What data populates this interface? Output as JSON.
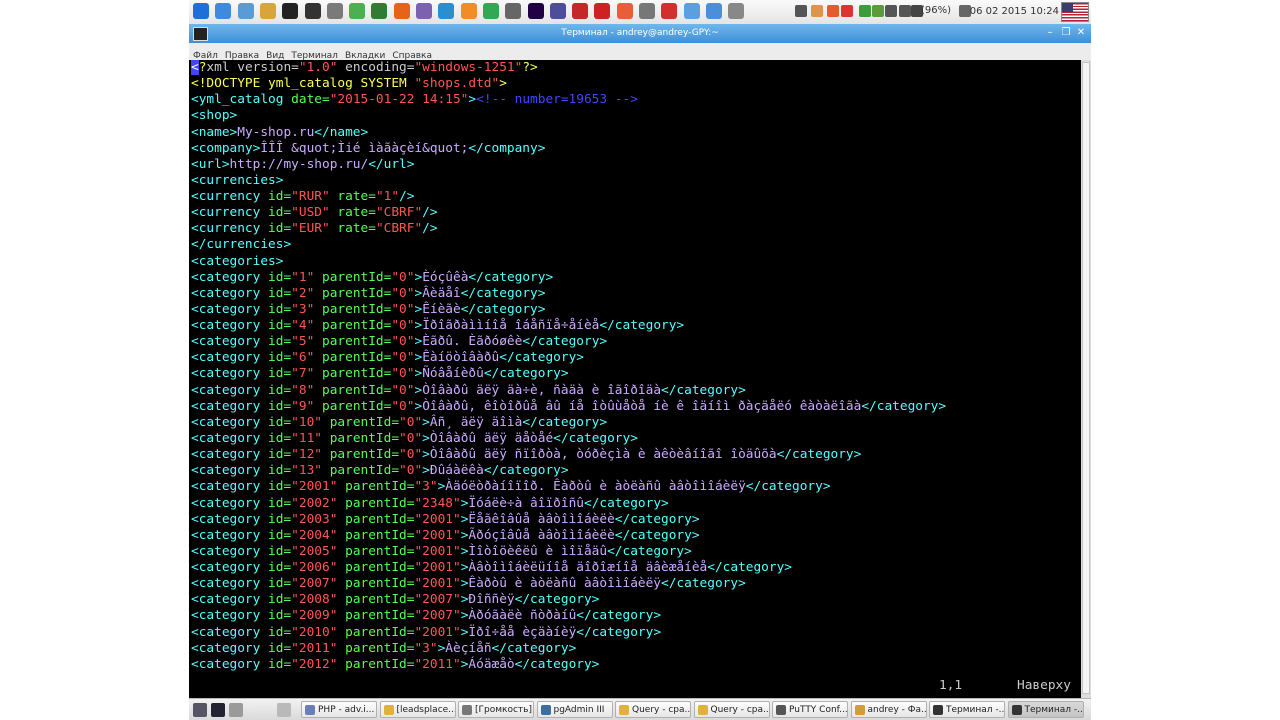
{
  "colors": {
    "tag": "#55ffff",
    "attr": "#55ff55",
    "value": "#ff5555",
    "text": "#ccaaff",
    "declaration": "#ffff55",
    "comment": "#4444ff",
    "cursor": "#4444ff",
    "default": "#cccccc"
  },
  "top_panel": {
    "launcher_icons": [
      "start-menu-icon",
      "files-icon",
      "globe-icon",
      "gimp-icon",
      "puzzle-icon",
      "terminal-icon",
      "pencil-icon",
      "play-icon",
      "leaf-icon",
      "firefox-icon",
      "bug-icon",
      "image-icon",
      "paint-icon",
      "spreadsheet-icon",
      "grid-icon",
      "monitor-icon",
      "circle-icon",
      "filezilla-icon",
      "opera-icon",
      "record-icon",
      "compass-icon",
      "stop-icon",
      "chat-icon",
      "mail-icon",
      "settings-icon"
    ],
    "tray_icons": [
      "bluetooth-icon",
      "clipboard-icon",
      "shield-icon",
      "calendar-icon",
      "download-icon",
      "update-icon",
      "network-icon",
      "volume-icon",
      "battery-icon",
      "mail-tray-icon"
    ],
    "battery": "(96%)",
    "datetime": "06 02 2015 10:24",
    "flag": "us-flag-icon"
  },
  "window": {
    "title": "Терминал - andrey@andrey-GPY:~"
  },
  "menu": [
    "Файл",
    "Правка",
    "Вид",
    "Терминал",
    "Вкладки",
    "Справка"
  ],
  "terminal": {
    "lines": [
      [
        [
          "cursor",
          "<"
        ],
        [
          "declaration",
          "?"
        ],
        [
          "default",
          "xml version="
        ],
        [
          "value",
          "\"1.0\""
        ],
        [
          "default",
          " encoding="
        ],
        [
          "value",
          "\"windows-1251\""
        ],
        [
          "declaration",
          "?>"
        ]
      ],
      [
        [
          "declaration",
          "<!DOCTYPE yml_catalog SYSTEM "
        ],
        [
          "value",
          "\"shops.dtd\""
        ],
        [
          "declaration",
          ">"
        ]
      ],
      [
        [
          "tag",
          "<yml_catalog "
        ],
        [
          "attr",
          "date="
        ],
        [
          "value",
          "\"2015-01-22 14:15\""
        ],
        [
          "tag",
          ">"
        ],
        [
          "comment",
          "<!-- number=19653 -->"
        ]
      ],
      [
        [
          "tag",
          "<shop>"
        ]
      ],
      [
        [
          "tag",
          "<name>"
        ],
        [
          "text",
          "My-shop.ru"
        ],
        [
          "tag",
          "</name>"
        ]
      ],
      [
        [
          "tag",
          "<company>"
        ],
        [
          "text",
          "ÎÎÎ &quot;Ìié ìàãàçèí&quot;"
        ],
        [
          "tag",
          "</company>"
        ]
      ],
      [
        [
          "tag",
          "<url>"
        ],
        [
          "text",
          "http://my-shop.ru/"
        ],
        [
          "tag",
          "</url>"
        ]
      ],
      [
        [
          "tag",
          "<currencies>"
        ]
      ],
      [
        [
          "tag",
          "<currency "
        ],
        [
          "attr",
          "id="
        ],
        [
          "value",
          "\"RUR\""
        ],
        [
          "attr",
          " rate="
        ],
        [
          "value",
          "\"1\""
        ],
        [
          "tag",
          "/>"
        ]
      ],
      [
        [
          "tag",
          "<currency "
        ],
        [
          "attr",
          "id="
        ],
        [
          "value",
          "\"USD\""
        ],
        [
          "attr",
          " rate="
        ],
        [
          "value",
          "\"CBRF\""
        ],
        [
          "tag",
          "/>"
        ]
      ],
      [
        [
          "tag",
          "<currency "
        ],
        [
          "attr",
          "id="
        ],
        [
          "value",
          "\"EUR\""
        ],
        [
          "attr",
          " rate="
        ],
        [
          "value",
          "\"CBRF\""
        ],
        [
          "tag",
          "/>"
        ]
      ],
      [
        [
          "tag",
          "</currencies>"
        ]
      ],
      [
        [
          "tag",
          "<categories>"
        ]
      ],
      [
        [
          "tag",
          "<category "
        ],
        [
          "attr",
          "id="
        ],
        [
          "value",
          "\"1\""
        ],
        [
          "attr",
          " parentId="
        ],
        [
          "value",
          "\"0\""
        ],
        [
          "tag",
          ">"
        ],
        [
          "text",
          "Èóçûêà"
        ],
        [
          "tag",
          "</category>"
        ]
      ],
      [
        [
          "tag",
          "<category "
        ],
        [
          "attr",
          "id="
        ],
        [
          "value",
          "\"2\""
        ],
        [
          "attr",
          " parentId="
        ],
        [
          "value",
          "\"0\""
        ],
        [
          "tag",
          ">"
        ],
        [
          "text",
          "Âèäåî"
        ],
        [
          "tag",
          "</category>"
        ]
      ],
      [
        [
          "tag",
          "<category "
        ],
        [
          "attr",
          "id="
        ],
        [
          "value",
          "\"3\""
        ],
        [
          "attr",
          " parentId="
        ],
        [
          "value",
          "\"0\""
        ],
        [
          "tag",
          ">"
        ],
        [
          "text",
          "Êíèãè"
        ],
        [
          "tag",
          "</category>"
        ]
      ],
      [
        [
          "tag",
          "<category "
        ],
        [
          "attr",
          "id="
        ],
        [
          "value",
          "\"4\""
        ],
        [
          "attr",
          " parentId="
        ],
        [
          "value",
          "\"0\""
        ],
        [
          "tag",
          ">"
        ],
        [
          "text",
          "Ïðîãðàììíîå îáåñïå÷åíèå"
        ],
        [
          "tag",
          "</category>"
        ]
      ],
      [
        [
          "tag",
          "<category "
        ],
        [
          "attr",
          "id="
        ],
        [
          "value",
          "\"5\""
        ],
        [
          "attr",
          " parentId="
        ],
        [
          "value",
          "\"0\""
        ],
        [
          "tag",
          ">"
        ],
        [
          "text",
          "Èãðû. Èãðóøêè"
        ],
        [
          "tag",
          "</category>"
        ]
      ],
      [
        [
          "tag",
          "<category "
        ],
        [
          "attr",
          "id="
        ],
        [
          "value",
          "\"6\""
        ],
        [
          "attr",
          " parentId="
        ],
        [
          "value",
          "\"0\""
        ],
        [
          "tag",
          ">"
        ],
        [
          "text",
          "Êàíöòîâàðû"
        ],
        [
          "tag",
          "</category>"
        ]
      ],
      [
        [
          "tag",
          "<category "
        ],
        [
          "attr",
          "id="
        ],
        [
          "value",
          "\"7\""
        ],
        [
          "attr",
          " parentId="
        ],
        [
          "value",
          "\"0\""
        ],
        [
          "tag",
          ">"
        ],
        [
          "text",
          "Ñóâåíèðû"
        ],
        [
          "tag",
          "</category>"
        ]
      ],
      [
        [
          "tag",
          "<category "
        ],
        [
          "attr",
          "id="
        ],
        [
          "value",
          "\"8\""
        ],
        [
          "attr",
          " parentId="
        ],
        [
          "value",
          "\"0\""
        ],
        [
          "tag",
          ">"
        ],
        [
          "text",
          "Òîâàðû äëÿ äà÷è, ñàäà è îãîðîäà"
        ],
        [
          "tag",
          "</category>"
        ]
      ],
      [
        [
          "tag",
          "<category "
        ],
        [
          "attr",
          "id="
        ],
        [
          "value",
          "\"9\""
        ],
        [
          "attr",
          " parentId="
        ],
        [
          "value",
          "\"0\""
        ],
        [
          "tag",
          ">"
        ],
        [
          "text",
          "Òîâàðû, êîòîðûå âû íå îòûùåòå íè ê îäíîì ðàçäåëó êàòàëîãà"
        ],
        [
          "tag",
          "</category>"
        ]
      ],
      [
        [
          "tag",
          "<category "
        ],
        [
          "attr",
          "id="
        ],
        [
          "value",
          "\"10\""
        ],
        [
          "attr",
          " parentId="
        ],
        [
          "value",
          "\"0\""
        ],
        [
          "tag",
          ">"
        ],
        [
          "text",
          "Âñ¸ äëÿ äîìà"
        ],
        [
          "tag",
          "</category>"
        ]
      ],
      [
        [
          "tag",
          "<category "
        ],
        [
          "attr",
          "id="
        ],
        [
          "value",
          "\"11\""
        ],
        [
          "attr",
          " parentId="
        ],
        [
          "value",
          "\"0\""
        ],
        [
          "tag",
          ">"
        ],
        [
          "text",
          "Òîâàðû äëÿ äåòåé"
        ],
        [
          "tag",
          "</category>"
        ]
      ],
      [
        [
          "tag",
          "<category "
        ],
        [
          "attr",
          "id="
        ],
        [
          "value",
          "\"12\""
        ],
        [
          "attr",
          " parentId="
        ],
        [
          "value",
          "\"0\""
        ],
        [
          "tag",
          ">"
        ],
        [
          "text",
          "Òîâàðû äëÿ ñïîðòà, òóðèçìà è àêòèâíîãî îòäûõà"
        ],
        [
          "tag",
          "</category>"
        ]
      ],
      [
        [
          "tag",
          "<category "
        ],
        [
          "attr",
          "id="
        ],
        [
          "value",
          "\"13\""
        ],
        [
          "attr",
          " parentId="
        ],
        [
          "value",
          "\"0\""
        ],
        [
          "tag",
          ">"
        ],
        [
          "text",
          "Ðûáàëêà"
        ],
        [
          "tag",
          "</category>"
        ]
      ],
      [
        [
          "tag",
          "<category "
        ],
        [
          "attr",
          "id="
        ],
        [
          "value",
          "\"2001\""
        ],
        [
          "attr",
          " parentId="
        ],
        [
          "value",
          "\"3\""
        ],
        [
          "tag",
          ">"
        ],
        [
          "text",
          "Àäóëòðàíîïîð. Êàðòû è àòëàñû àâòîìîáèëÿ"
        ],
        [
          "tag",
          "</category>"
        ]
      ],
      [
        [
          "tag",
          "<category "
        ],
        [
          "attr",
          "id="
        ],
        [
          "value",
          "\"2002\""
        ],
        [
          "attr",
          " parentId="
        ],
        [
          "value",
          "\"2348\""
        ],
        [
          "tag",
          ">"
        ],
        [
          "text",
          "Ïóáëè÷à âîïðîñû"
        ],
        [
          "tag",
          "</category>"
        ]
      ],
      [
        [
          "tag",
          "<category "
        ],
        [
          "attr",
          "id="
        ],
        [
          "value",
          "\"2003\""
        ],
        [
          "attr",
          " parentId="
        ],
        [
          "value",
          "\"2001\""
        ],
        [
          "tag",
          ">"
        ],
        [
          "text",
          "Ëåãêîâûå àâòîìîáèëè"
        ],
        [
          "tag",
          "</category>"
        ]
      ],
      [
        [
          "tag",
          "<category "
        ],
        [
          "attr",
          "id="
        ],
        [
          "value",
          "\"2004\""
        ],
        [
          "attr",
          " parentId="
        ],
        [
          "value",
          "\"2001\""
        ],
        [
          "tag",
          ">"
        ],
        [
          "text",
          "Ãðóçîâûå àâòîìîáèëè"
        ],
        [
          "tag",
          "</category>"
        ]
      ],
      [
        [
          "tag",
          "<category "
        ],
        [
          "attr",
          "id="
        ],
        [
          "value",
          "\"2005\""
        ],
        [
          "attr",
          " parentId="
        ],
        [
          "value",
          "\"2001\""
        ],
        [
          "tag",
          ">"
        ],
        [
          "text",
          "Ìîòîöèêëû è ìîïåäû"
        ],
        [
          "tag",
          "</category>"
        ]
      ],
      [
        [
          "tag",
          "<category "
        ],
        [
          "attr",
          "id="
        ],
        [
          "value",
          "\"2006\""
        ],
        [
          "attr",
          " parentId="
        ],
        [
          "value",
          "\"2001\""
        ],
        [
          "tag",
          ">"
        ],
        [
          "text",
          "Àâòîìîáèëüíîå äîðîæíîå äâèæåíèå"
        ],
        [
          "tag",
          "</category>"
        ]
      ],
      [
        [
          "tag",
          "<category "
        ],
        [
          "attr",
          "id="
        ],
        [
          "value",
          "\"2007\""
        ],
        [
          "attr",
          " parentId="
        ],
        [
          "value",
          "\"2001\""
        ],
        [
          "tag",
          ">"
        ],
        [
          "text",
          "Êàðòû è àòëàñû àâòîìîáèëÿ"
        ],
        [
          "tag",
          "</category>"
        ]
      ],
      [
        [
          "tag",
          "<category "
        ],
        [
          "attr",
          "id="
        ],
        [
          "value",
          "\"2008\""
        ],
        [
          "attr",
          " parentId="
        ],
        [
          "value",
          "\"2007\""
        ],
        [
          "tag",
          ">"
        ],
        [
          "text",
          "Ðîññèÿ"
        ],
        [
          "tag",
          "</category>"
        ]
      ],
      [
        [
          "tag",
          "<category "
        ],
        [
          "attr",
          "id="
        ],
        [
          "value",
          "\"2009\""
        ],
        [
          "attr",
          " parentId="
        ],
        [
          "value",
          "\"2007\""
        ],
        [
          "tag",
          ">"
        ],
        [
          "text",
          "Àðóãàëè ñòðàíû"
        ],
        [
          "tag",
          "</category>"
        ]
      ],
      [
        [
          "tag",
          "<category "
        ],
        [
          "attr",
          "id="
        ],
        [
          "value",
          "\"2010\""
        ],
        [
          "attr",
          " parentId="
        ],
        [
          "value",
          "\"2001\""
        ],
        [
          "tag",
          ">"
        ],
        [
          "text",
          "Ïðî÷åå èçäàíèÿ"
        ],
        [
          "tag",
          "</category>"
        ]
      ],
      [
        [
          "tag",
          "<category "
        ],
        [
          "attr",
          "id="
        ],
        [
          "value",
          "\"2011\""
        ],
        [
          "attr",
          " parentId="
        ],
        [
          "value",
          "\"3\""
        ],
        [
          "tag",
          ">"
        ],
        [
          "text",
          "Àèçíåñ"
        ],
        [
          "tag",
          "</category>"
        ]
      ],
      [
        [
          "tag",
          "<category "
        ],
        [
          "attr",
          "id="
        ],
        [
          "value",
          "\"2012\""
        ],
        [
          "attr",
          " parentId="
        ],
        [
          "value",
          "\"2011\""
        ],
        [
          "tag",
          ">"
        ],
        [
          "text",
          "Áóäæåò"
        ],
        [
          "tag",
          "</category>"
        ]
      ]
    ],
    "status": {
      "position": "1,1",
      "scroll": "Наверху"
    }
  },
  "taskbar": [
    {
      "label": "PHP - adv.i...",
      "icon": "php-icon"
    },
    {
      "label": "[leadsplace...",
      "icon": "folder-icon"
    },
    {
      "label": "[Громкость]",
      "icon": "volume-icon"
    },
    {
      "label": "pgAdmin III",
      "icon": "elephant-icon"
    },
    {
      "label": "Query - сра...",
      "icon": "query-icon"
    },
    {
      "label": "Query - сра...",
      "icon": "query-icon"
    },
    {
      "label": "PuTTY Conf...",
      "icon": "putty-icon"
    },
    {
      "label": "andrey - Фа...",
      "icon": "home-icon"
    },
    {
      "label": "Терминал -...",
      "icon": "terminal-icon"
    },
    {
      "label": "Терминал -...",
      "icon": "terminal-icon"
    }
  ]
}
